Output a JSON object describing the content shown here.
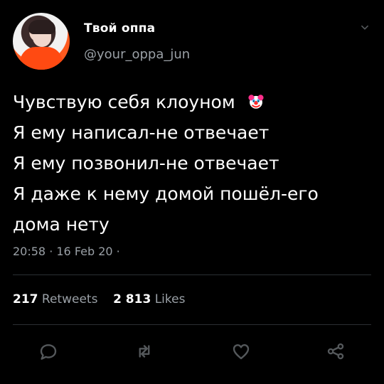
{
  "profile": {
    "display_name": "Твой оппа",
    "handle": "@your_oppa_jun"
  },
  "tweet": {
    "lines": [
      "Чувствую себя клоуном",
      "Я ему написал-не отвечает",
      "Я ему позвонил-не отвечает",
      "Я даже к нему домой пошёл-его",
      "дома нету"
    ],
    "emoji": "clown-face-icon",
    "timestamp": "20:58 · 16 Feb 20 ·"
  },
  "stats": {
    "retweets_count": "217",
    "retweets_label": "Retweets",
    "likes_count": "2 813",
    "likes_label": "Likes"
  },
  "actions": {
    "reply_icon": "reply-icon",
    "retweet_icon": "retweet-icon",
    "like_icon": "heart-icon",
    "share_icon": "share-icon"
  },
  "colors": {
    "background": "#000000",
    "primary_text": "#ffffff",
    "secondary_text": "#9aa0a6",
    "divider": "#2b2f33"
  }
}
